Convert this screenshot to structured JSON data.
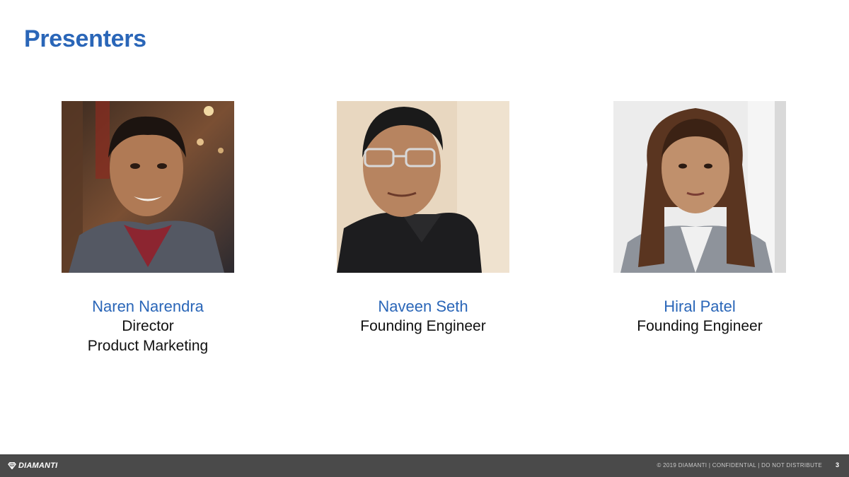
{
  "slide": {
    "title": "Presenters"
  },
  "presenters": [
    {
      "name": "Naren Narendra",
      "role_line1": "Director",
      "role_line2": "Product Marketing"
    },
    {
      "name": "Naveen Seth",
      "role_line1": "Founding Engineer",
      "role_line2": ""
    },
    {
      "name": "Hiral Patel",
      "role_line1": "Founding Engineer",
      "role_line2": ""
    }
  ],
  "footer": {
    "logo_text": "DIAMANTI",
    "logo_icon": "diamond-icon",
    "note": "© 2019 DIAMANTI  |  CONFIDENTIAL  |  DO NOT DISTRIBUTE",
    "page_number": "3"
  },
  "colors": {
    "accent": "#2a66b8",
    "footer_bg": "#4a4a4a",
    "text": "#111111"
  }
}
